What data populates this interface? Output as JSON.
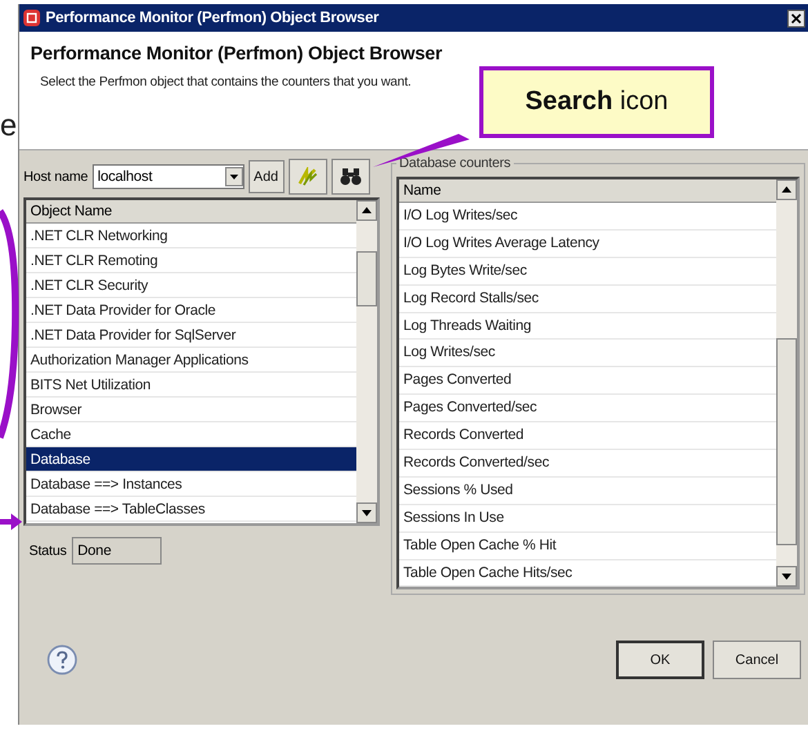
{
  "slide_fragment": "e",
  "window": {
    "title": "Performance Monitor (Perfmon) Object Browser"
  },
  "header": {
    "title": "Performance Monitor (Perfmon) Object Browser",
    "description": "Select the Perfmon object that contains the counters that you want."
  },
  "host": {
    "label": "Host name",
    "value": "localhost",
    "add_button": "Add"
  },
  "objects": {
    "column": "Object Name",
    "rows": [
      {
        "name": ".NET CLR Networking",
        "selected": false
      },
      {
        "name": ".NET CLR Remoting",
        "selected": false
      },
      {
        "name": ".NET CLR Security",
        "selected": false
      },
      {
        "name": ".NET Data Provider for Oracle",
        "selected": false
      },
      {
        "name": ".NET Data Provider for SqlServer",
        "selected": false
      },
      {
        "name": "Authorization Manager Applications",
        "selected": false
      },
      {
        "name": "BITS Net Utilization",
        "selected": false
      },
      {
        "name": "Browser",
        "selected": false
      },
      {
        "name": "Cache",
        "selected": false
      },
      {
        "name": "Database",
        "selected": true
      },
      {
        "name": "Database ==> Instances",
        "selected": false
      },
      {
        "name": "Database ==> TableClasses",
        "selected": false
      }
    ]
  },
  "status": {
    "label": "Status",
    "value": "Done"
  },
  "counters": {
    "group_label": "Database counters",
    "column": "Name",
    "rows": [
      "I/O Log Writes/sec",
      "I/O Log Writes Average Latency",
      "Log Bytes Write/sec",
      "Log Record Stalls/sec",
      "Log Threads Waiting",
      "Log Writes/sec",
      "Pages Converted",
      "Pages Converted/sec",
      "Records Converted",
      "Records Converted/sec",
      "Sessions % Used",
      "Sessions In Use",
      "Table Open Cache % Hit",
      "Table Open Cache Hits/sec"
    ]
  },
  "buttons": [
    "OK",
    "Cancel"
  ],
  "annotation": {
    "text": "**Search** icon"
  }
}
